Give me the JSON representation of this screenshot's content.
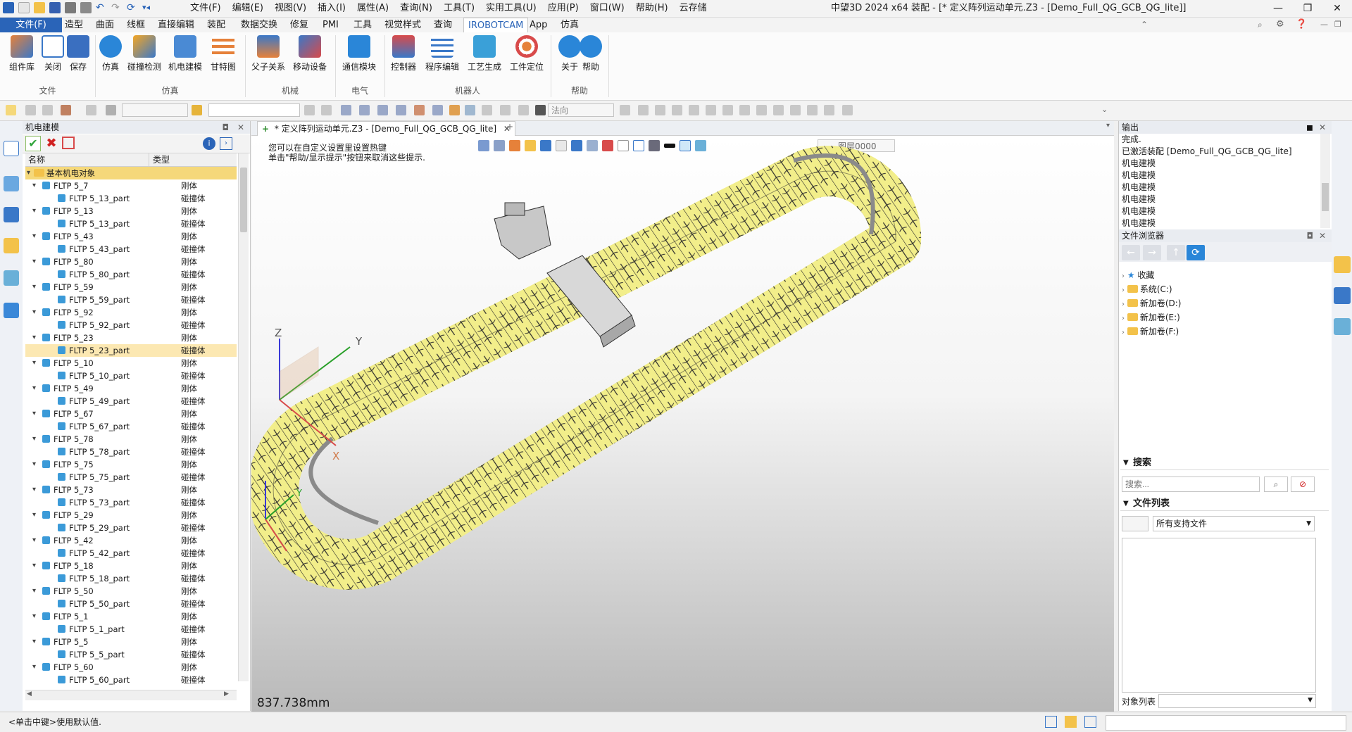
{
  "menu": [
    "文件(F)",
    "编辑(E)",
    "视图(V)",
    "插入(I)",
    "属性(A)",
    "查询(N)",
    "工具(T)",
    "实用工具(U)",
    "应用(P)",
    "窗口(W)",
    "帮助(H)",
    "云存储"
  ],
  "window_title": "中望3D 2024 x64        装配 - [* 定义阵列运动单元.Z3 - [Demo_Full_QG_GCB_QG_lite]]",
  "tabs": [
    "文件(F)",
    "造型",
    "曲面",
    "线框",
    "直接编辑",
    "装配",
    "数据交换",
    "修复",
    "PMI",
    "工具",
    "视觉样式",
    "查询",
    "IROBOTCAM",
    "App",
    "仿真"
  ],
  "search_cmd_placeholder": "搜索命令",
  "ribbon": {
    "buttons": [
      "组件库",
      "关闭",
      "保存",
      "仿真",
      "碰撞检测",
      "机电建模",
      "甘特图",
      "父子关系",
      "移动设备",
      "通信模块",
      "控制器",
      "程序编辑",
      "工艺生成",
      "工件定位",
      "关于",
      "帮助"
    ],
    "groups": [
      "文件",
      "仿真",
      "机械",
      "电气",
      "机器人",
      "帮助"
    ]
  },
  "toolbar": {
    "combo_label": "法向"
  },
  "left_panel": {
    "title": "机电建模",
    "col_name": "名称",
    "col_type": "类型",
    "root": "基本机电对象",
    "rows": [
      {
        "name": "FLTP 5_7",
        "type": "刚体",
        "level": 1
      },
      {
        "name": "FLTP 5_13_part",
        "type": "碰撞体",
        "level": 2
      },
      {
        "name": "FLTP 5_13",
        "type": "刚体",
        "level": 1
      },
      {
        "name": "FLTP 5_13_part",
        "type": "碰撞体",
        "level": 2
      },
      {
        "name": "FLTP 5_43",
        "type": "刚体",
        "level": 1
      },
      {
        "name": "FLTP 5_43_part",
        "type": "碰撞体",
        "level": 2
      },
      {
        "name": "FLTP 5_80",
        "type": "刚体",
        "level": 1
      },
      {
        "name": "FLTP 5_80_part",
        "type": "碰撞体",
        "level": 2
      },
      {
        "name": "FLTP 5_59",
        "type": "刚体",
        "level": 1
      },
      {
        "name": "FLTP 5_59_part",
        "type": "碰撞体",
        "level": 2
      },
      {
        "name": "FLTP 5_92",
        "type": "刚体",
        "level": 1
      },
      {
        "name": "FLTP 5_92_part",
        "type": "碰撞体",
        "level": 2
      },
      {
        "name": "FLTP 5_23",
        "type": "刚体",
        "level": 1
      },
      {
        "name": "FLTP 5_23_part",
        "type": "碰撞体",
        "level": 2,
        "selected": true
      },
      {
        "name": "FLTP 5_10",
        "type": "刚体",
        "level": 1
      },
      {
        "name": "FLTP 5_10_part",
        "type": "碰撞体",
        "level": 2
      },
      {
        "name": "FLTP 5_49",
        "type": "刚体",
        "level": 1
      },
      {
        "name": "FLTP 5_49_part",
        "type": "碰撞体",
        "level": 2
      },
      {
        "name": "FLTP 5_67",
        "type": "刚体",
        "level": 1
      },
      {
        "name": "FLTP 5_67_part",
        "type": "碰撞体",
        "level": 2
      },
      {
        "name": "FLTP 5_78",
        "type": "刚体",
        "level": 1
      },
      {
        "name": "FLTP 5_78_part",
        "type": "碰撞体",
        "level": 2
      },
      {
        "name": "FLTP 5_75",
        "type": "刚体",
        "level": 1
      },
      {
        "name": "FLTP 5_75_part",
        "type": "碰撞体",
        "level": 2
      },
      {
        "name": "FLTP 5_73",
        "type": "刚体",
        "level": 1
      },
      {
        "name": "FLTP 5_73_part",
        "type": "碰撞体",
        "level": 2
      },
      {
        "name": "FLTP 5_29",
        "type": "刚体",
        "level": 1
      },
      {
        "name": "FLTP 5_29_part",
        "type": "碰撞体",
        "level": 2
      },
      {
        "name": "FLTP 5_42",
        "type": "刚体",
        "level": 1
      },
      {
        "name": "FLTP 5_42_part",
        "type": "碰撞体",
        "level": 2
      },
      {
        "name": "FLTP 5_18",
        "type": "刚体",
        "level": 1
      },
      {
        "name": "FLTP 5_18_part",
        "type": "碰撞体",
        "level": 2
      },
      {
        "name": "FLTP 5_50",
        "type": "刚体",
        "level": 1
      },
      {
        "name": "FLTP 5_50_part",
        "type": "碰撞体",
        "level": 2
      },
      {
        "name": "FLTP 5_1",
        "type": "刚体",
        "level": 1
      },
      {
        "name": "FLTP 5_1_part",
        "type": "碰撞体",
        "level": 2
      },
      {
        "name": "FLTP 5_5",
        "type": "刚体",
        "level": 1
      },
      {
        "name": "FLTP 5_5_part",
        "type": "碰撞体",
        "level": 2
      },
      {
        "name": "FLTP 5_60",
        "type": "刚体",
        "level": 1
      },
      {
        "name": "FLTP 5_60_part",
        "type": "碰撞体",
        "level": 2
      }
    ]
  },
  "document_tab": "* 定义阵列运动单元.Z3 - [Demo_Full_QG_GCB_QG_lite]",
  "viewport": {
    "hint_line1": "您可以在自定义设置里设置热键",
    "hint_line2": "单击\"帮助/显示提示\"按钮来取消这些提示.",
    "scale": "837.738mm",
    "layer": "图层0000",
    "axes": {
      "x": "X",
      "y": "Y",
      "z": "Z"
    }
  },
  "output": {
    "title": "输出",
    "lines": [
      "完成.",
      "已激活装配 [Demo_Full_QG_GCB_QG_lite]",
      "机电建模",
      "机电建模",
      "机电建模",
      "机电建模",
      "机电建模",
      "机电建模"
    ]
  },
  "file_browser": {
    "title": "文件浏览器",
    "items": [
      "收藏",
      "系统(C:)",
      "新加卷(D:)",
      "新加卷(E:)",
      "新加卷(F:)"
    ],
    "search_title": "搜索",
    "search_placeholder": "搜索...",
    "file_list_title": "文件列表",
    "file_filter": "所有支持文件",
    "object_list_label": "对象列表"
  },
  "status": "<单击中键>使用默认值.",
  "colors": {
    "accent": "#2a64b8",
    "chain_fill": "#f2ee8a",
    "selection": "#fce8b2"
  }
}
